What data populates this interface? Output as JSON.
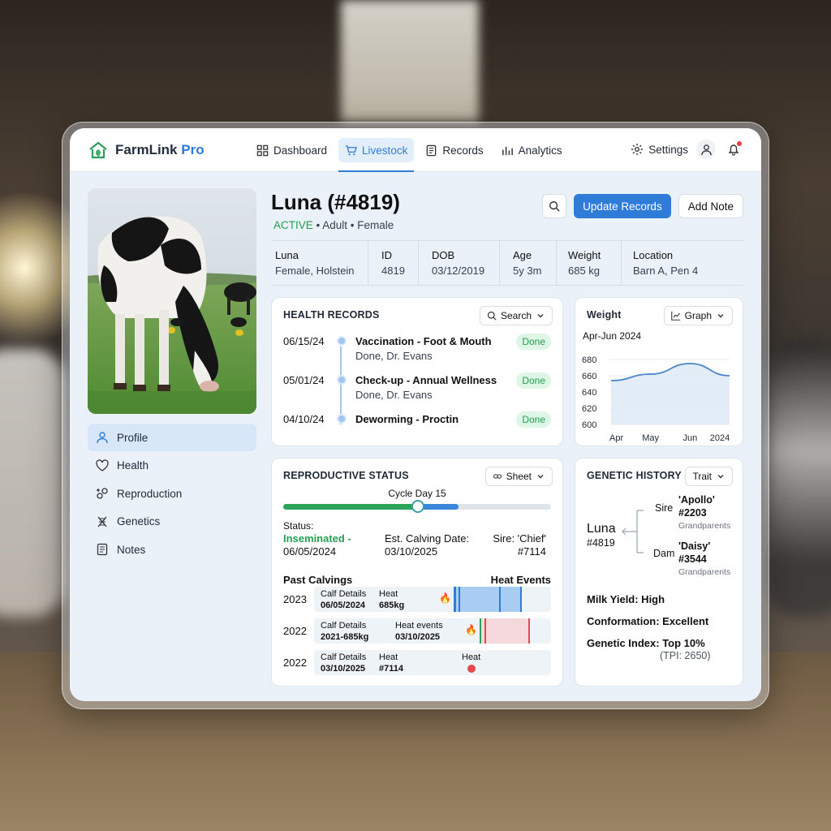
{
  "app": {
    "brand_a": "FarmLink",
    "brand_b": "Pro"
  },
  "nav": [
    {
      "label": "Dashboard",
      "icon": "grid-icon"
    },
    {
      "label": "Livestock",
      "icon": "cart-icon",
      "active": true
    },
    {
      "label": "Records",
      "icon": "document-icon"
    },
    {
      "label": "Analytics",
      "icon": "bar-chart-icon"
    }
  ],
  "topright": {
    "settings": "Settings"
  },
  "sidebar": [
    {
      "label": "Profile",
      "active": true
    },
    {
      "label": "Health"
    },
    {
      "label": "Reproduction"
    },
    {
      "label": "Genetics"
    },
    {
      "label": "Notes"
    }
  ],
  "animal": {
    "title": "Luna (#4819)",
    "status": "ACTIVE",
    "sub_rest": " • Adult • Female",
    "info": [
      {
        "k": "Luna",
        "v": "Female, Holstein"
      },
      {
        "k": "ID",
        "v": "4819"
      },
      {
        "k": "DOB",
        "v": "03/12/2019"
      },
      {
        "k": "Age",
        "v": "5y 3m"
      },
      {
        "k": "Weight",
        "v": "685 kg"
      },
      {
        "k": "Location",
        "v": "Barn A, Pen 4"
      }
    ]
  },
  "actions": {
    "update": "Update Records",
    "note": "Add Note"
  },
  "health": {
    "title": "HEALTH RECORDS",
    "search": "Search",
    "rows": [
      {
        "date": "06/15/24",
        "title": "Vaccination - Foot & Mouth",
        "sub": "Done, Dr. Evans",
        "badge": "Done"
      },
      {
        "date": "05/01/24",
        "title": "Check-up - Annual Wellness",
        "sub": "Done, Dr. Evans",
        "badge": "Done"
      },
      {
        "date": "04/10/24",
        "title": "Deworming - Proctin",
        "sub": "",
        "badge": "Done"
      }
    ]
  },
  "weight": {
    "title": "Weight",
    "mode": "Graph",
    "range": "Apr-Jun 2024"
  },
  "chart_data": {
    "type": "area",
    "x": [
      "Apr",
      "May",
      "Jun",
      "2024"
    ],
    "y": [
      654,
      662,
      675,
      660
    ],
    "ylim": [
      600,
      680
    ],
    "yticks": [
      600,
      620,
      640,
      660,
      680
    ],
    "color": "#4a86c8"
  },
  "repro": {
    "title": "REPRODUCTIVE STATUS",
    "mode": "Sheet",
    "cycle": "Cycle Day 15",
    "cycle_progress": 0.65,
    "status_label": "Status:",
    "status_value": "Inseminated -",
    "status_date": "06/05/2024",
    "calving_label": "Est. Calving Date:",
    "calving_date": "03/10/2025",
    "sire": "Sire: 'Chief'",
    "sire_id": "#7114",
    "past": "Past Calvings",
    "heat": "Heat Events",
    "calvings": [
      {
        "year": "2023",
        "a1": "Calf Details",
        "b1": "06/05/2024",
        "a2": "Heat",
        "b2": "685kg"
      },
      {
        "year": "2022",
        "a1": "Calf Details",
        "b1": "2021-685kg",
        "a2": "Heat events",
        "b2": "03/10/2025"
      },
      {
        "year": "2022",
        "a1": "Calf Details",
        "b1": "03/10/2025",
        "a2": "Heat",
        "b2": "#7114",
        "a3": "Heat"
      }
    ]
  },
  "genetic": {
    "title": "GENETIC HISTORY",
    "mode": "Trait",
    "name": "Luna",
    "id": "#4819",
    "sire_label": "Sire",
    "sire_name": "'Apollo'",
    "sire_id": "#2203",
    "dam_label": "Dam",
    "dam_name": "'Daisy'",
    "dam_id": "#3544",
    "gp": "Grandparents",
    "milk": "Milk Yield: High",
    "conf": "Conformation: Excellent",
    "index": "Genetic Index: Top 10%",
    "tpi": "(TPI: 2650)"
  }
}
